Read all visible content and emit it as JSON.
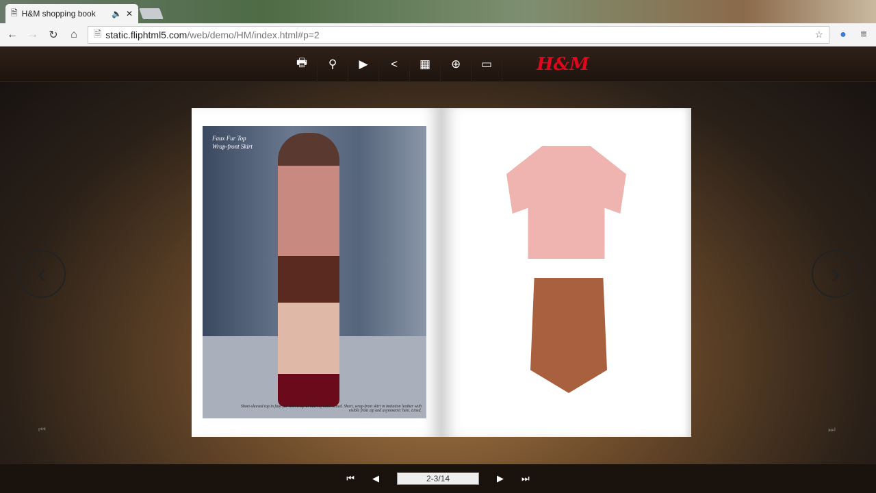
{
  "browser": {
    "tab_title": "H&M shopping book",
    "url_host": "static.fliphtml5.com",
    "url_path": "/web/demo/HM/index.html#p=2"
  },
  "toolbar": {
    "icons": [
      "print-icon",
      "search-icon",
      "autoplay-icon",
      "share-icon",
      "thumbnails-icon",
      "zoom-icon",
      "fullscreen-icon"
    ],
    "logo": "H&M"
  },
  "page_left": {
    "caption_line1": "Faux Fur Top",
    "caption_line2": "Wrap-front Skirt",
    "description": "Short-sleeved top in faux fur with a zip at back of neck. Lined. Short, wrap-front skirt in imitation leather with visible front zip and asymmetric hem. Lined."
  },
  "pager": {
    "value": "2-3/14"
  }
}
